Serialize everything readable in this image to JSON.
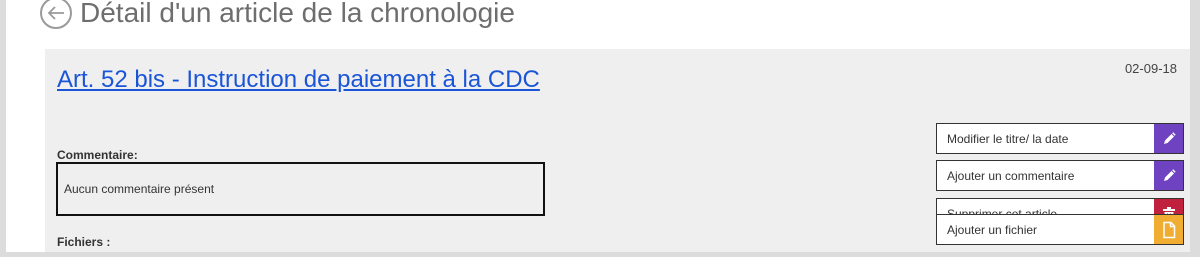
{
  "header": {
    "title": "Détail d'un article de la chronologie"
  },
  "article": {
    "date": "02-09-18",
    "title": "Art. 52 bis - Instruction de paiement à la CDC",
    "comment_label": "Commentaire:",
    "comment_text": "Aucun commentaire présent",
    "files_label": "Fichiers :"
  },
  "actions": [
    {
      "label": "Modifier le titre/ la date",
      "icon": "pencil-icon",
      "color": "#6f42c1"
    },
    {
      "label": "Ajouter un commentaire",
      "icon": "pencil-icon",
      "color": "#6f42c1"
    },
    {
      "label": "Supprimer cet article",
      "icon": "trash-icon",
      "color": "#c0223d"
    },
    {
      "label": "Ajouter un fichier",
      "icon": "file-icon",
      "color": "#f0ad32"
    }
  ],
  "colors": {
    "link": "#1a55d8",
    "panel_bg": "#efefef"
  }
}
